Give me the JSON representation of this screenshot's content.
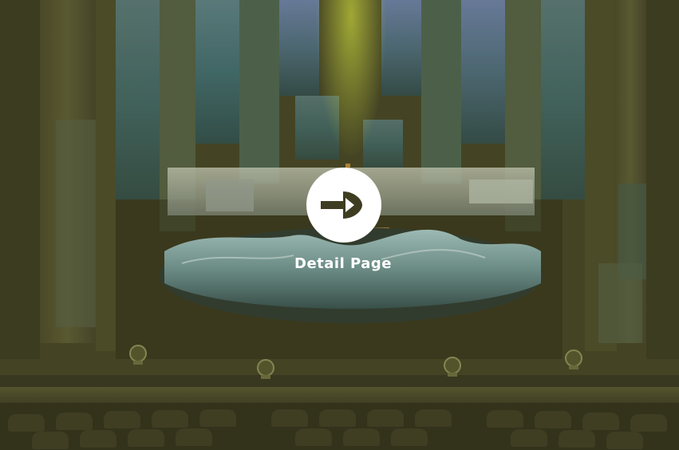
{
  "overlay": {
    "cta_label": "Detail Page",
    "cta_icon": "arrow-right-icon"
  },
  "colors": {
    "overlay_tint": "#4d4c26",
    "cta_fill": "#ffffff",
    "cta_arrow": "#3e3d21",
    "spotlight_beam": "#c0c83c",
    "sea": "#7fa7a8"
  }
}
